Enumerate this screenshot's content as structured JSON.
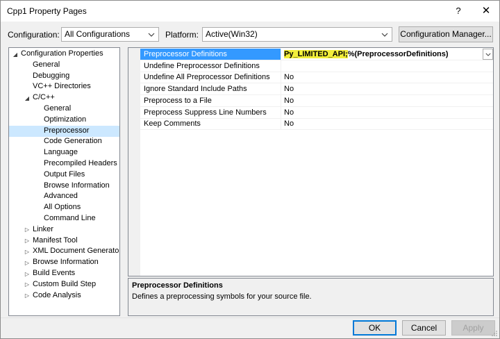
{
  "window": {
    "title": "Cpp1 Property Pages",
    "help_glyph": "?",
    "close_glyph": "✕"
  },
  "toolbar": {
    "configuration_label": "Configuration:",
    "configuration_value": "All Configurations",
    "platform_label": "Platform:",
    "platform_value": "Active(Win32)",
    "config_manager_label": "Configuration Manager..."
  },
  "tree": [
    {
      "label": "Configuration Properties",
      "level": 0,
      "expander": "open"
    },
    {
      "label": "General",
      "level": 1
    },
    {
      "label": "Debugging",
      "level": 1
    },
    {
      "label": "VC++ Directories",
      "level": 1
    },
    {
      "label": "C/C++",
      "level": 1,
      "expander": "open"
    },
    {
      "label": "General",
      "level": 2
    },
    {
      "label": "Optimization",
      "level": 2
    },
    {
      "label": "Preprocessor",
      "level": 2,
      "selected": true
    },
    {
      "label": "Code Generation",
      "level": 2
    },
    {
      "label": "Language",
      "level": 2
    },
    {
      "label": "Precompiled Headers",
      "level": 2
    },
    {
      "label": "Output Files",
      "level": 2
    },
    {
      "label": "Browse Information",
      "level": 2
    },
    {
      "label": "Advanced",
      "level": 2
    },
    {
      "label": "All Options",
      "level": 2
    },
    {
      "label": "Command Line",
      "level": 2
    },
    {
      "label": "Linker",
      "level": 1,
      "expander": "closed"
    },
    {
      "label": "Manifest Tool",
      "level": 1,
      "expander": "closed"
    },
    {
      "label": "XML Document Generator",
      "level": 1,
      "expander": "closed"
    },
    {
      "label": "Browse Information",
      "level": 1,
      "expander": "closed"
    },
    {
      "label": "Build Events",
      "level": 1,
      "expander": "closed"
    },
    {
      "label": "Custom Build Step",
      "level": 1,
      "expander": "closed"
    },
    {
      "label": "Code Analysis",
      "level": 1,
      "expander": "closed"
    }
  ],
  "properties": [
    {
      "name": "Preprocessor Definitions",
      "value_highlight": "Py_LIMITED_API;",
      "value": "%(PreprocessorDefinitions)",
      "selected": true
    },
    {
      "name": "Undefine Preprocessor Definitions",
      "value": ""
    },
    {
      "name": "Undefine All Preprocessor Definitions",
      "value": "No"
    },
    {
      "name": "Ignore Standard Include Paths",
      "value": "No"
    },
    {
      "name": "Preprocess to a File",
      "value": "No"
    },
    {
      "name": "Preprocess Suppress Line Numbers",
      "value": "No"
    },
    {
      "name": "Keep Comments",
      "value": "No"
    }
  ],
  "description": {
    "title": "Preprocessor Definitions",
    "text": "Defines a preprocessing symbols for your source file."
  },
  "buttons": {
    "ok": "OK",
    "cancel": "Cancel",
    "apply": "Apply"
  },
  "colors": {
    "selection": "#3399ff",
    "tree_selection": "#cce8ff",
    "highlight": "#f2ee3a",
    "default_button_border": "#0078d7"
  }
}
